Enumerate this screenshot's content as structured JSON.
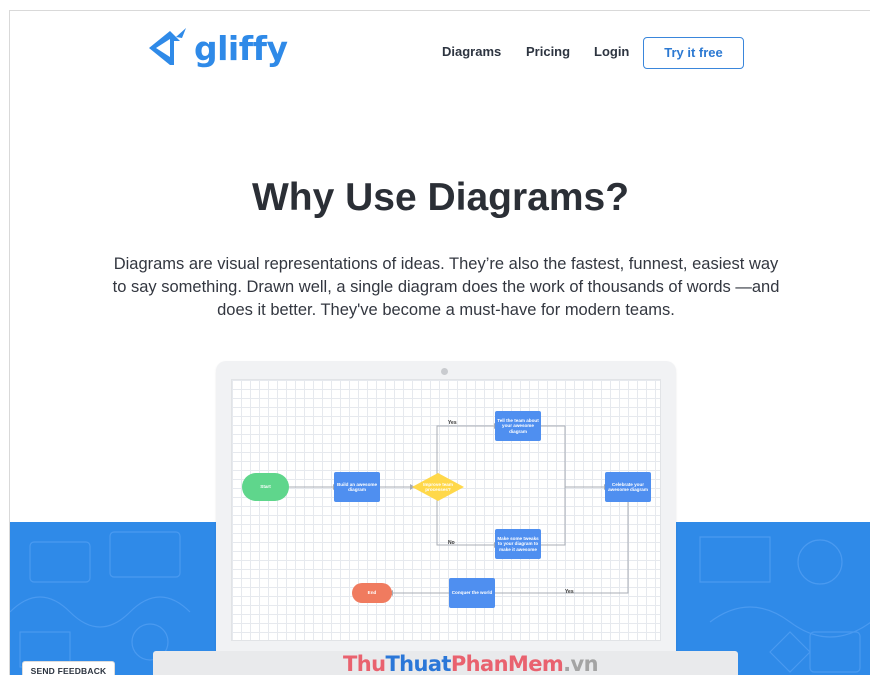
{
  "brand": {
    "name": "gliffy",
    "color": "#2f8ae8"
  },
  "nav": {
    "diagrams": "Diagrams",
    "pricing": "Pricing",
    "login": "Login",
    "try_label": "Try it free"
  },
  "hero": {
    "title": "Why Use Diagrams?",
    "description": "Diagrams are visual representations of ideas. They’re also the fastest, funnest, easiest way to say something. Drawn well, a single diagram does the work of thousands of words —and does it better. They've become a must-have for modern teams."
  },
  "flowchart": {
    "start": "Start",
    "build": "Build an awesome diagram",
    "decision": "Improve team processes?",
    "tell": "Tell the team about your awesome diagram",
    "celebrate": "Celebrate your awesome diagram",
    "tweaks": "Make some tweaks to your diagram to make it awesome",
    "conquer": "Conquer the world",
    "end": "End",
    "yes_label": "Yes",
    "no_label": "No",
    "yes_label_bottom": "Yes"
  },
  "feedback": {
    "label": "SEND FEEDBACK"
  },
  "watermark": {
    "part1": "Thu",
    "part2": "Thuat",
    "part3": "PhanMem",
    "part4": ".vn"
  },
  "colors": {
    "accent": "#2f8ae8",
    "start_node": "#5fd68c",
    "decision": "#ffd84a",
    "end_node": "#f07b5f",
    "box_node": "#4f8ff0"
  }
}
